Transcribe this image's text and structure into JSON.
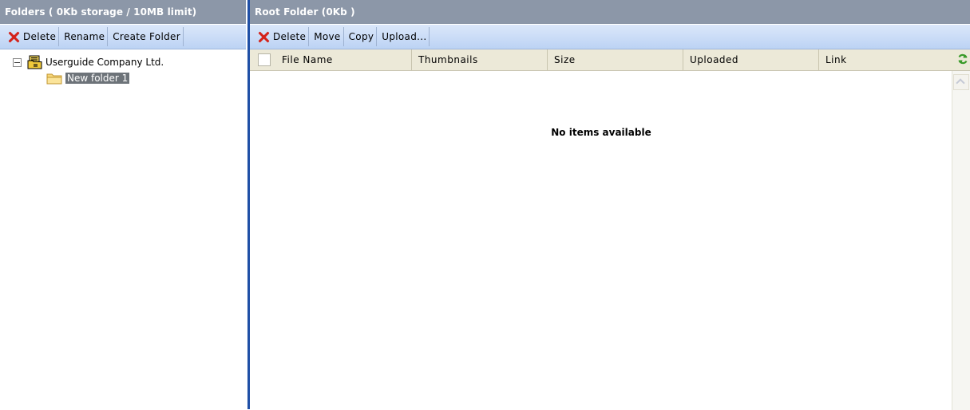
{
  "left_panel": {
    "header": "Folders ( 0Kb storage / 10MB limit)",
    "toolbar": {
      "delete": "Delete",
      "rename": "Rename",
      "create_folder": "Create Folder"
    },
    "tree": {
      "root": "Userguide Company Ltd.",
      "children": [
        "New folder 1"
      ]
    }
  },
  "right_panel": {
    "header": "Root Folder (0Kb )",
    "toolbar": {
      "delete": "Delete",
      "move": "Move",
      "copy": "Copy",
      "upload": "Upload..."
    },
    "columns": [
      "File Name",
      "Thumbnails",
      "Size",
      "Uploaded",
      "Link"
    ],
    "empty_message": "No items available"
  },
  "colors": {
    "header_bg": "#8c97a8",
    "toolbar_bg": "#c9dbf5",
    "splitter": "#1f4fa6",
    "selection_bg": "#6d7379",
    "delete_icon": "#d4221a",
    "refresh_icon": "#3a9b2a"
  },
  "icons": {
    "delete": "x-icon",
    "company": "company-folder-icon",
    "folder": "folder-icon",
    "tree_toggle": "collapse-icon",
    "refresh": "refresh-icon",
    "scroll_up": "scroll-up-icon"
  }
}
